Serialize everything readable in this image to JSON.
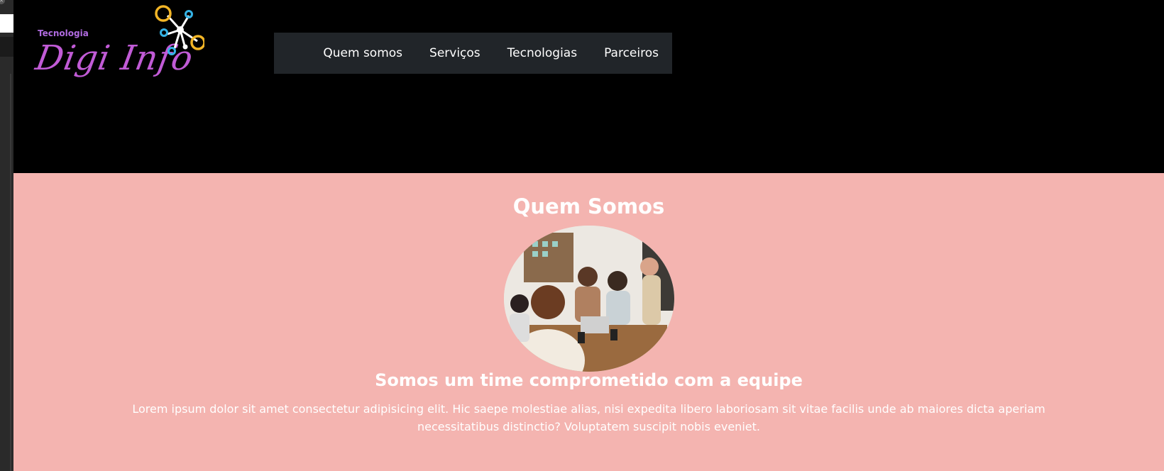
{
  "header": {
    "logo": {
      "small_text": "Tecnologia",
      "brand_text": "Digi Info"
    },
    "nav": {
      "items": [
        {
          "label": "Quem somos"
        },
        {
          "label": "Serviços"
        },
        {
          "label": "Tecnologias"
        },
        {
          "label": "Parceiros"
        }
      ]
    }
  },
  "about": {
    "title": "Quem Somos",
    "subtitle": "Somos um time comprometido com a equipe",
    "text": "Lorem ipsum dolor sit amet consectetur adipisicing elit. Hic saepe molestiae alias, nisi expedita libero laboriosam sit vitae facilis unde ab maiores dicta aperiam necessitatibus distinctio? Voluptatem suscipit nobis eveniet."
  },
  "colors": {
    "header_bg": "#000000",
    "nav_bg": "#212529",
    "section_bg": "#f4b4b0",
    "logo_purple": "#c15bd6",
    "logo_yellow": "#f2b526",
    "logo_blue": "#35b3e6"
  }
}
